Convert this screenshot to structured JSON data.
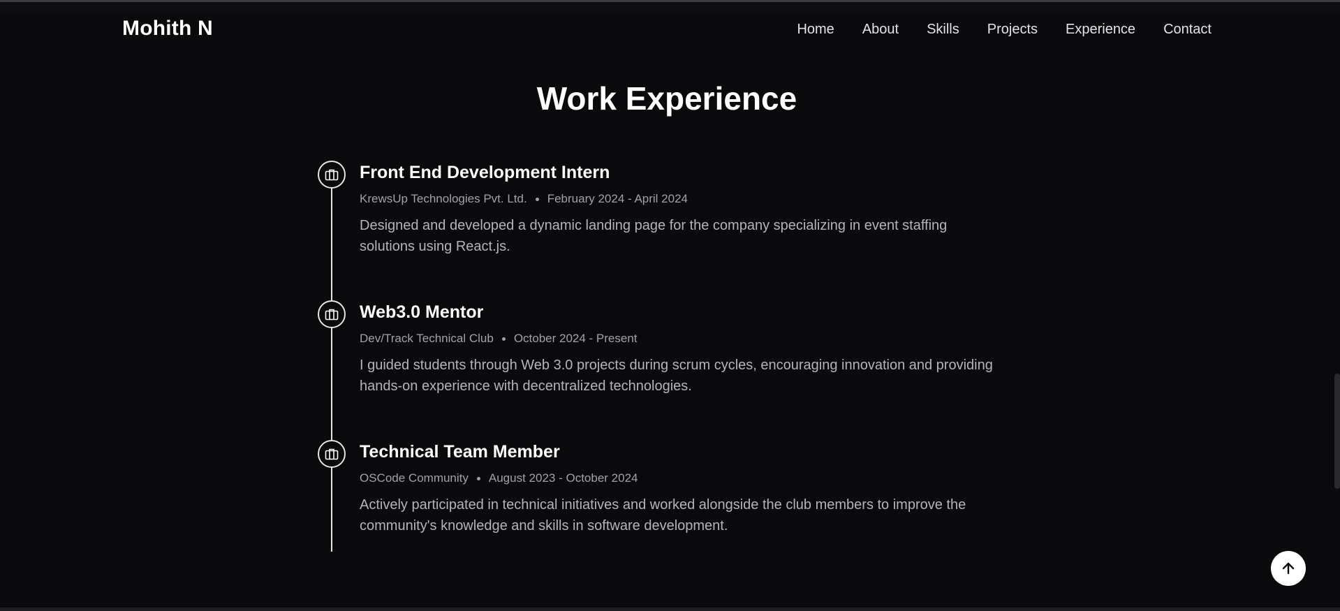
{
  "navbar": {
    "brand": "Mohith N",
    "links": [
      "Home",
      "About",
      "Skills",
      "Projects",
      "Experience",
      "Contact"
    ]
  },
  "section": {
    "title": "Work Experience"
  },
  "experience": [
    {
      "role": "Front End Development Intern",
      "company": "KrewsUp Technologies Pvt. Ltd.",
      "period": "February 2024 - April 2024",
      "description": "Designed and developed a dynamic landing page for the company specializing in event staffing solutions using React.js.",
      "icon": "briefcase-icon"
    },
    {
      "role": "Web3.0 Mentor",
      "company": "Dev/Track Technical Club",
      "period": "October 2024 - Present",
      "description": "I guided students through Web 3.0 projects during scrum cycles, encouraging innovation and providing hands-on experience with decentralized technologies.",
      "icon": "briefcase-icon"
    },
    {
      "role": "Technical Team Member",
      "company": "OSCode Community",
      "period": "August 2023 - October 2024",
      "description": "Actively participated in technical initiatives and worked alongside the club members to improve the community's knowledge and skills in software development.",
      "icon": "briefcase-icon"
    }
  ],
  "scroll_top": {
    "icon": "arrow-up-icon"
  },
  "colors": {
    "background": "#0a0a0c",
    "text": "#ffffff",
    "muted": "#a1a1aa"
  }
}
